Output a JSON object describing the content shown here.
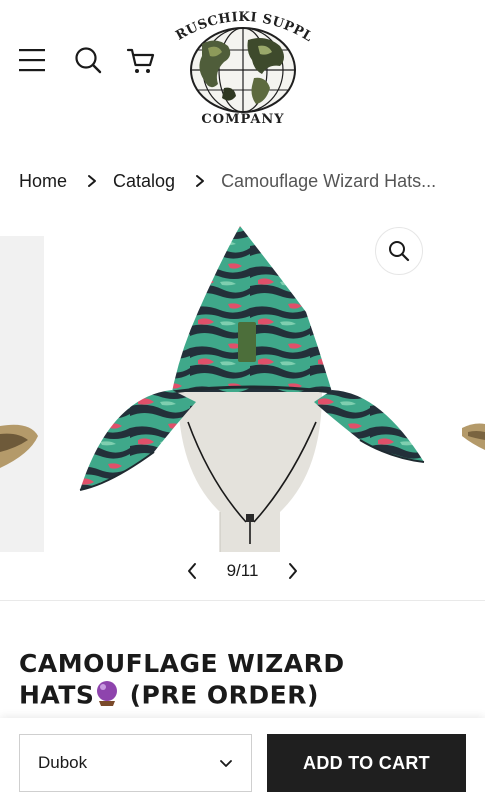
{
  "header": {
    "logo_top_text": "KRUSCHIKI SUPPLY",
    "logo_bottom_text": "COMPANY",
    "icons": [
      "menu-icon",
      "search-icon",
      "cart-icon"
    ]
  },
  "breadcrumb": {
    "home": "Home",
    "catalog": "Catalog",
    "current": "Camouflage Wizard Hats..."
  },
  "gallery": {
    "counter": "9/11",
    "icons": [
      "zoom-icon",
      "chevron-left-icon",
      "chevron-right-icon"
    ]
  },
  "product": {
    "title_line1": "CAMOUFLAGE WIZARD",
    "title_line2_pre": "HATS",
    "title_line2_post": " (PRE ORDER)"
  },
  "purchase": {
    "variant_selected": "Dubok",
    "add_to_cart_label": "ADD TO CART"
  },
  "colors": {
    "accent": "#1f1f1f",
    "camo_green": "#3fa88a",
    "camo_pink": "#e0506a",
    "camo_dark": "#23303a",
    "orb_purple": "#8e44ad"
  }
}
